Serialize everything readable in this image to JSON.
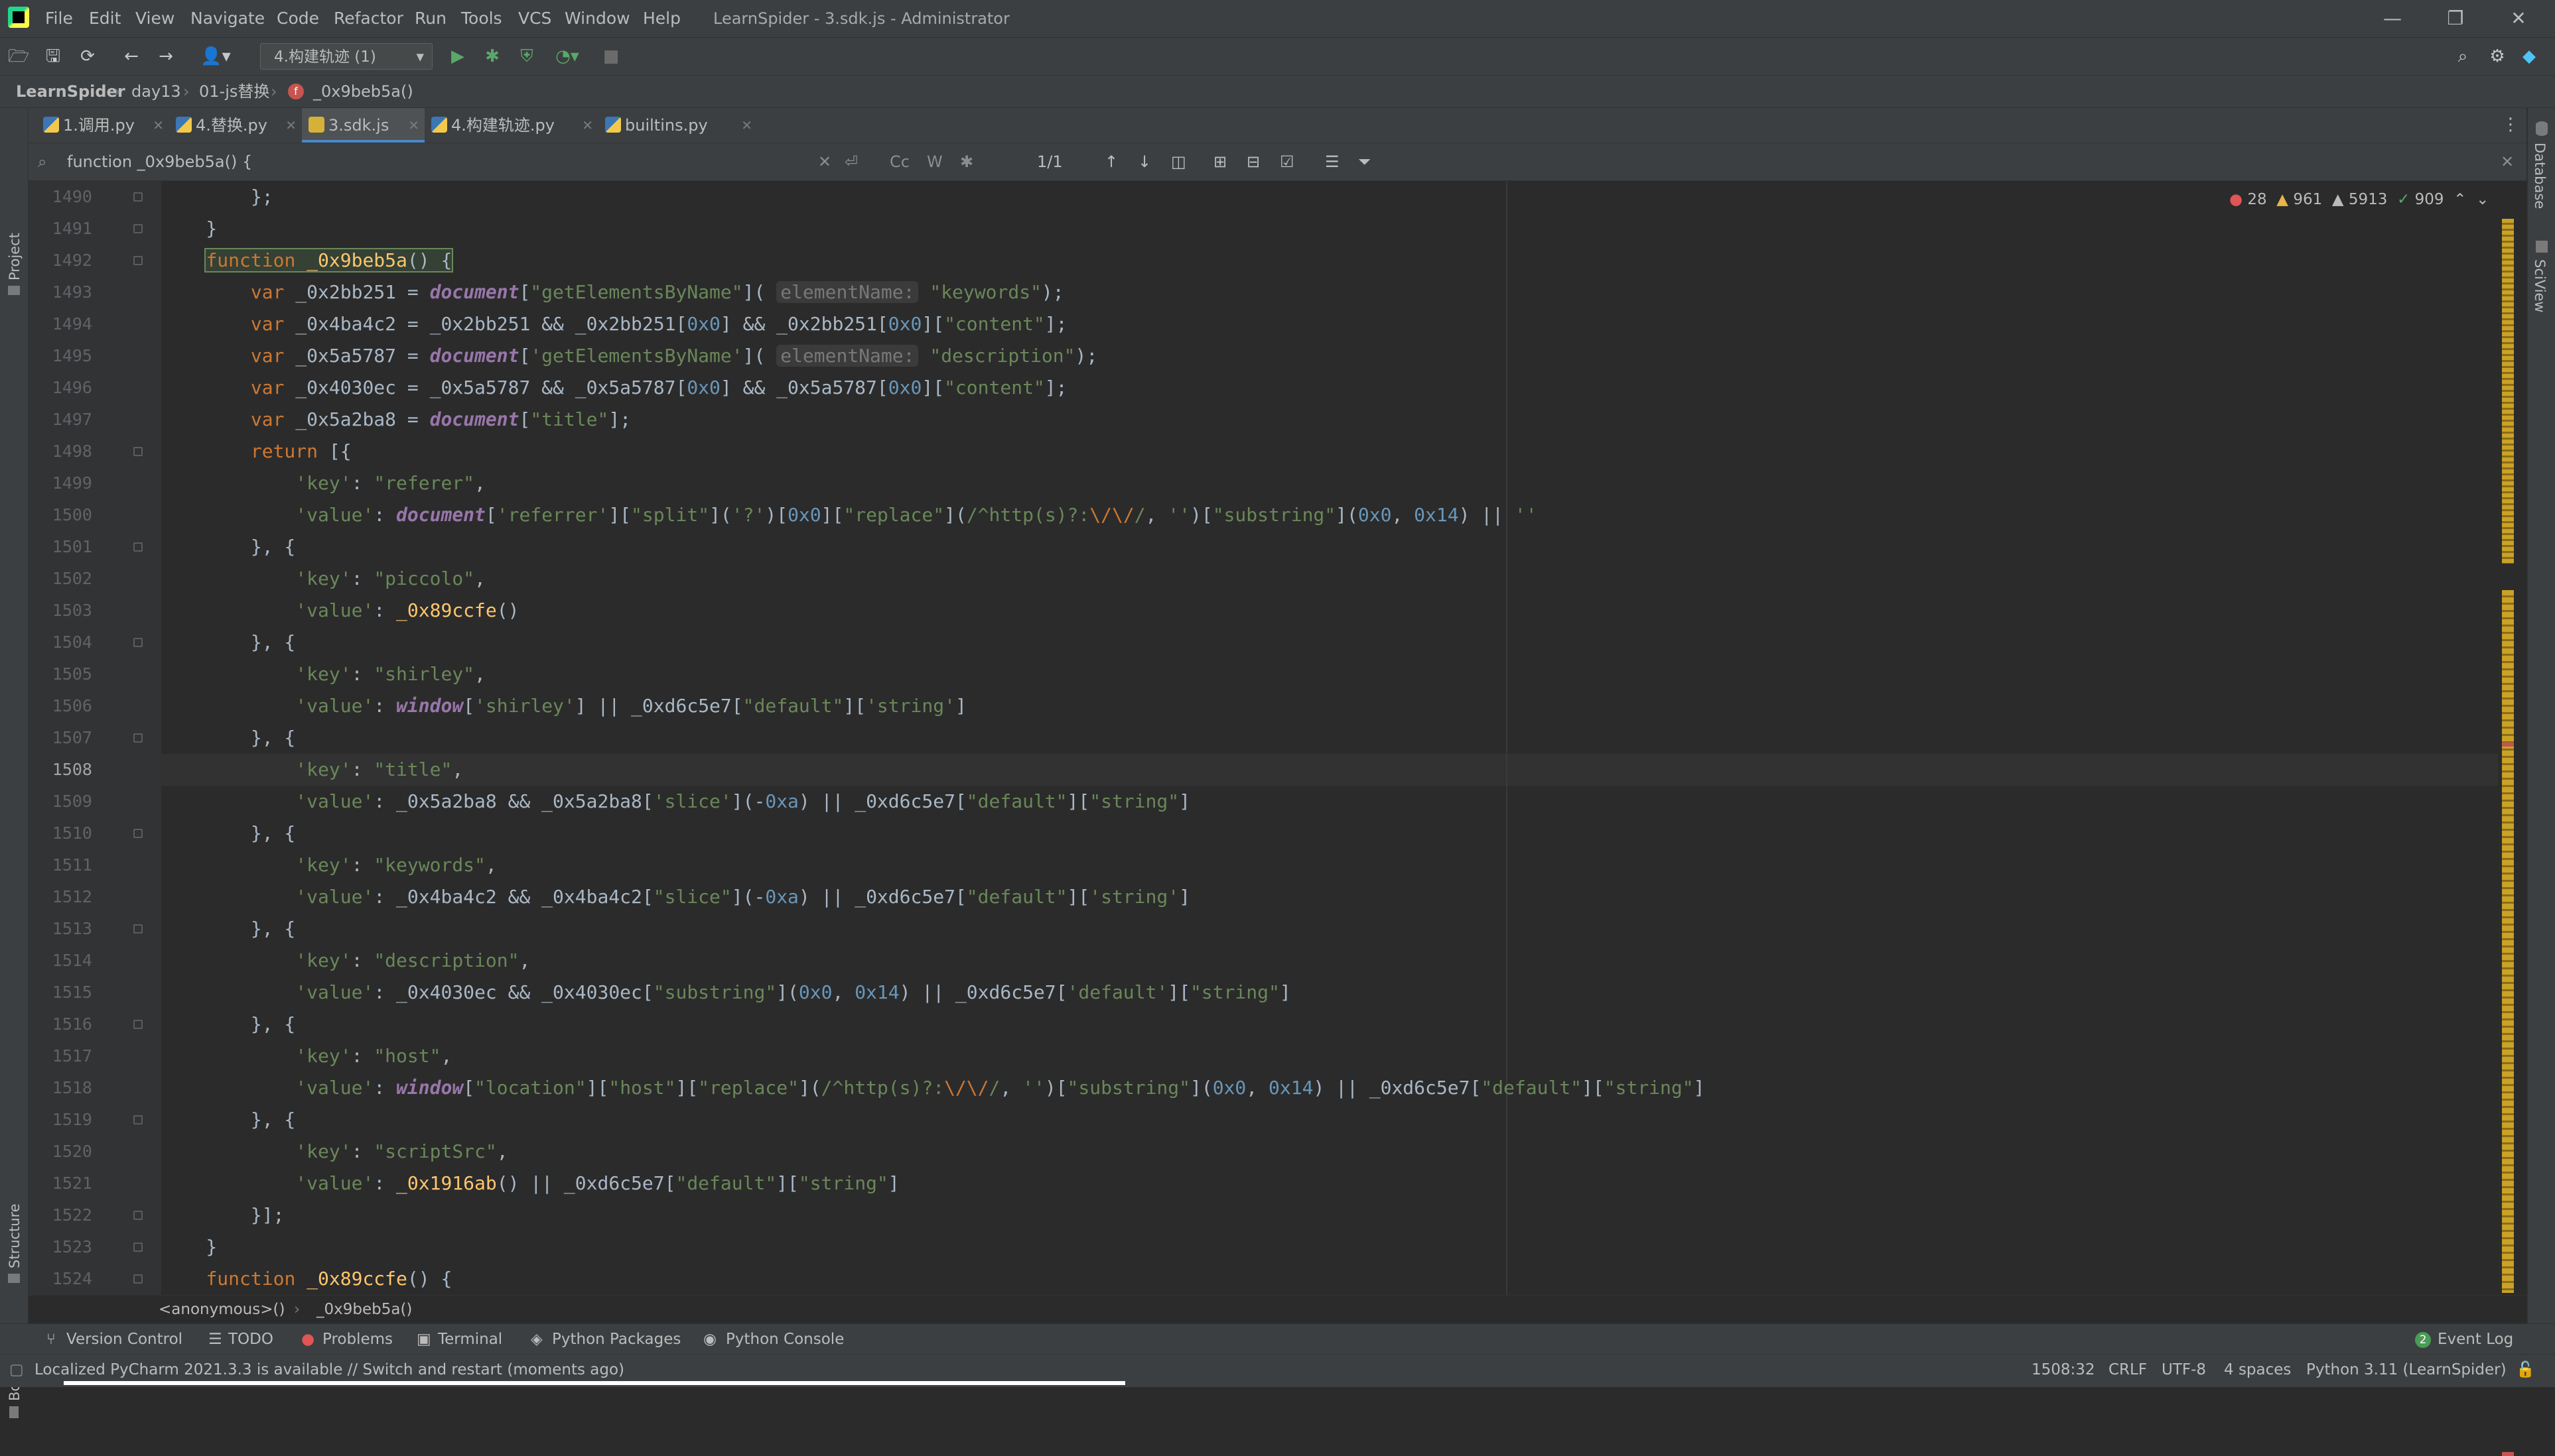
{
  "window": {
    "title": "LearnSpider - 3.sdk.js - Administrator",
    "minimize": "—",
    "restore": "❐",
    "close": "✕"
  },
  "menu": [
    "File",
    "Edit",
    "View",
    "Navigate",
    "Code",
    "Refactor",
    "Run",
    "Tools",
    "VCS",
    "Window",
    "Help"
  ],
  "toolbar": {
    "run_config": "4.构建轨迹 (1)"
  },
  "breadcrumbs": [
    "LearnSpider",
    "day13",
    "01-js替换",
    "_0x9beb5a()"
  ],
  "tabs": [
    {
      "label": "1.调用.py"
    },
    {
      "label": "4.替换.py"
    },
    {
      "label": "3.sdk.js"
    },
    {
      "label": "4.构建轨迹.py"
    },
    {
      "label": "builtins.py"
    }
  ],
  "search": {
    "query": "function _0x9beb5a() {",
    "match_count": "1/1",
    "case_label": "Cc",
    "word_label": "W"
  },
  "inspections": {
    "errors": "28",
    "warnings": "961",
    "weak_warnings": "5913",
    "ok": "909"
  },
  "editor": {
    "current_line": "1508",
    "line_numbers": [
      "1490",
      "1491",
      "1492",
      "1493",
      "1494",
      "1495",
      "1496",
      "1497",
      "1498",
      "1499",
      "1500",
      "1501",
      "1502",
      "1503",
      "1504",
      "1505",
      "1506",
      "1507",
      "1508",
      "1509",
      "1510",
      "1511",
      "1512",
      "1513",
      "1514",
      "1515",
      "1516",
      "1517",
      "1518",
      "1519",
      "1520",
      "1521",
      "1522",
      "1523",
      "1524"
    ],
    "hint_elementName": "elementName:"
  },
  "editor_crumbs": [
    "<anonymous>()",
    "_0x9beb5a()"
  ],
  "left_stripe": {
    "project": "Project",
    "structure": "Structure",
    "bookmarks": "Bookmarks"
  },
  "right_stripe": {
    "database": "Database",
    "sciview": "SciView"
  },
  "tool_windows": [
    "Version Control",
    "TODO",
    "Problems",
    "Terminal",
    "Python Packages",
    "Python Console"
  ],
  "event_log": {
    "count": "2",
    "label": "Event Log"
  },
  "status": {
    "message": "Localized PyCharm 2021.3.3 is available // Switch and restart (moments ago)",
    "position": "1508:32",
    "line_sep": "CRLF",
    "encoding": "UTF-8",
    "indent": "4 spaces",
    "interpreter": "Python 3.11 (LearnSpider)"
  }
}
